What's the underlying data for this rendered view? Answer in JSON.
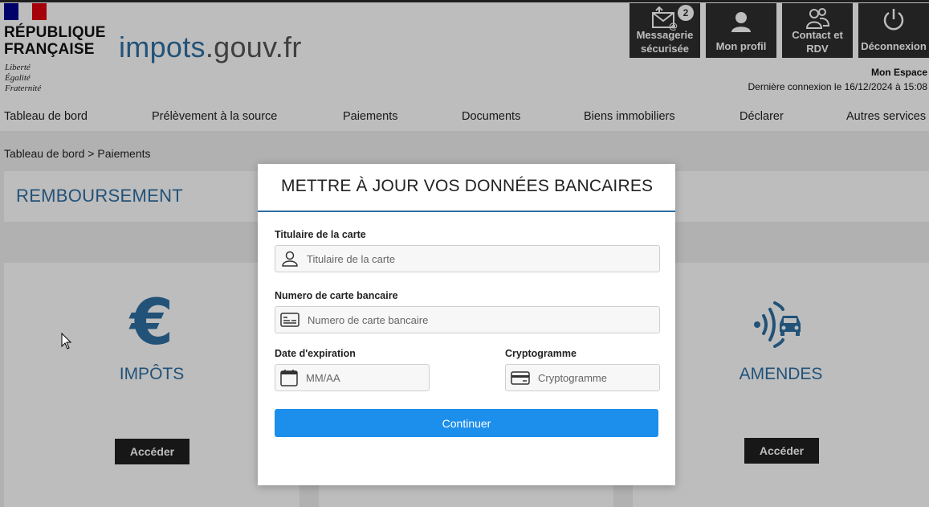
{
  "header": {
    "gov_line1": "RÉPUBLIQUE",
    "gov_line2": "FRANÇAISE",
    "motto": [
      "Liberté",
      "Égalité",
      "Fraternité"
    ],
    "brand_main": "impots",
    "brand_domain": ".gouv.fr",
    "tools": {
      "messagerie": {
        "label1": "Messagerie",
        "label2": "sécurisée",
        "badge": "2",
        "icon": "mail-envelope-icon"
      },
      "profil": {
        "label": "Mon profil",
        "icon": "user-icon"
      },
      "contact": {
        "label1": "Contact et",
        "label2": "RDV",
        "icon": "people-icon"
      },
      "deconnexion": {
        "label": "Déconnexion",
        "icon": "power-icon"
      }
    },
    "espace": "Mon Espace",
    "last_connection": "Dernière connexion le 16/12/2024 à 15:08"
  },
  "nav": {
    "items": [
      {
        "label": "Tableau de bord"
      },
      {
        "label": "Prélèvement à la source"
      },
      {
        "label": "Paiements"
      },
      {
        "label": "Documents"
      },
      {
        "label": "Biens immobiliers"
      },
      {
        "label": "Déclarer"
      },
      {
        "label": "Autres services"
      }
    ],
    "active": "Paiements"
  },
  "breadcrumb": "Tableau de bord > Paiements",
  "remboursement": {
    "title": "REMBOURSEMENT"
  },
  "tiles": [
    {
      "title": "IMPÔTS",
      "icon": "euro-icon",
      "button": "Accéder"
    },
    {
      "title": "AMENDES",
      "icon": "speed-camera-car-icon",
      "button": "Accéder"
    }
  ],
  "modal": {
    "title": "METTRE À JOUR VOS DONNÉES BANCAIRES",
    "fields": {
      "holder": {
        "label": "Titulaire de la carte",
        "placeholder": "Titulaire de la carte",
        "icon": "user-icon"
      },
      "card_number": {
        "label": "Numero de carte bancaire",
        "placeholder": "Numero de carte bancaire",
        "icon": "credit-card-icon"
      },
      "expiry": {
        "label": "Date d'expiration",
        "placeholder": "MM/AA",
        "icon": "calendar-icon"
      },
      "cvv": {
        "label": "Cryptogramme",
        "placeholder": "Cryptogramme",
        "icon": "card-icon"
      }
    },
    "submit_label": "Continuer"
  },
  "colors": {
    "brand_blue": "#2f6fa3",
    "button_blue": "#1c8fec",
    "dark_button": "#2f2f2f"
  }
}
